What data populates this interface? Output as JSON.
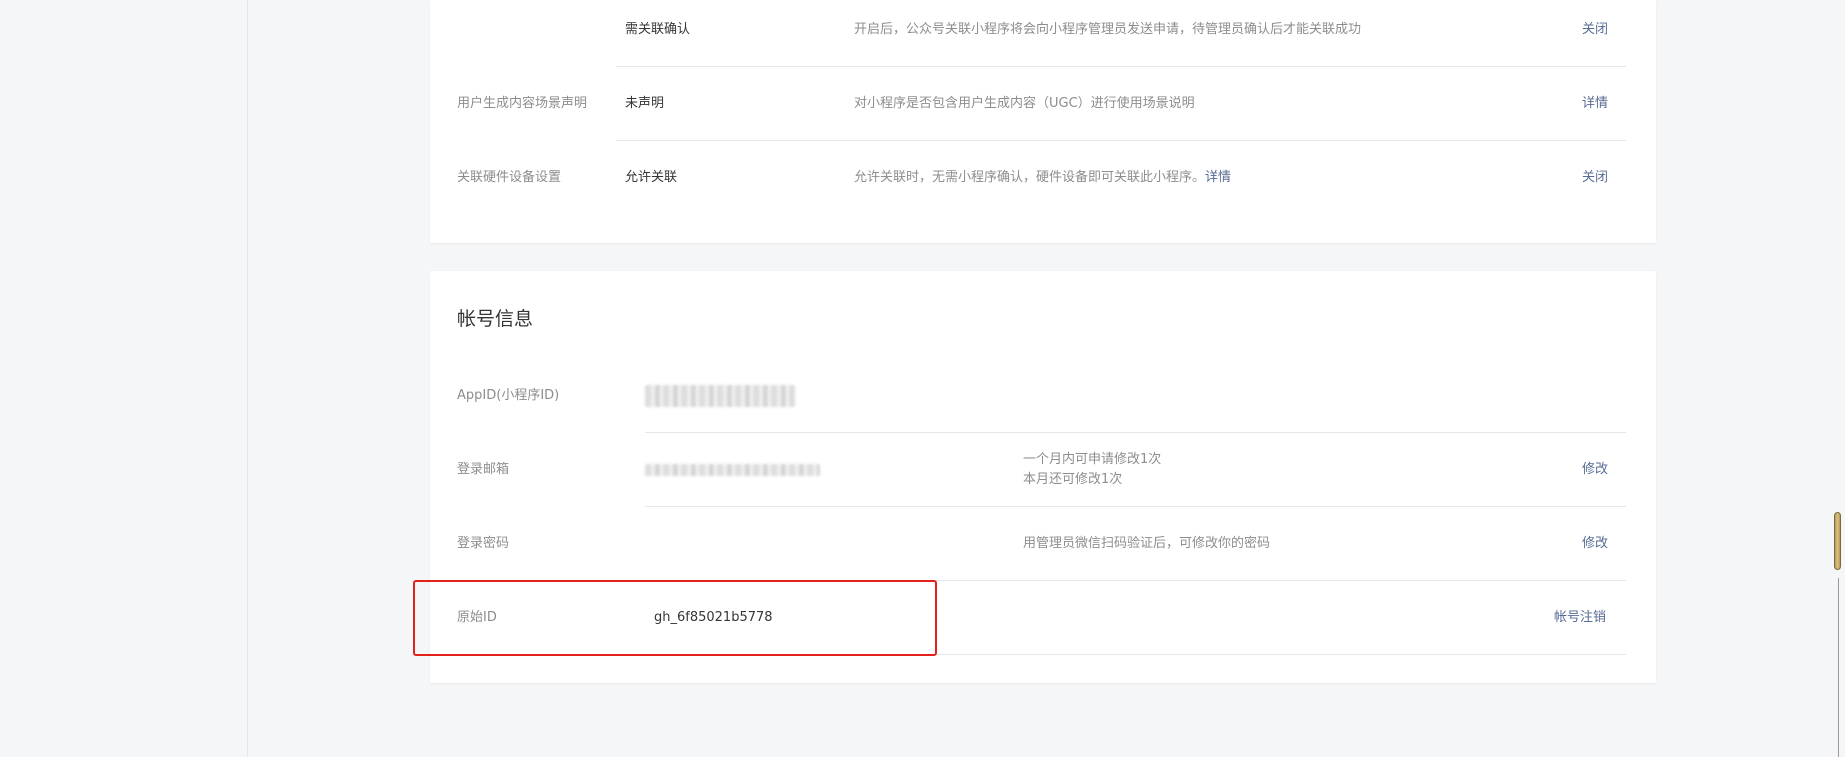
{
  "top_card": {
    "rows": [
      {
        "label": "",
        "value": "需关联确认",
        "desc": "开启后，公众号关联小程序将会向小程序管理员发送申请，待管理员确认后才能关联成功",
        "action": "关闭"
      },
      {
        "label": "用户生成内容场景声明",
        "value": "未声明",
        "desc": "对小程序是否包含用户生成内容（UGC）进行使用场景说明",
        "action": "详情"
      },
      {
        "label": "关联硬件设备设置",
        "value": "允许关联",
        "desc": "允许关联时，无需小程序确认，硬件设备即可关联此小程序。",
        "desc_link": "详情",
        "action": "关闭"
      }
    ]
  },
  "account_card": {
    "title": "帐号信息",
    "appid": {
      "label": "AppID(小程序ID)"
    },
    "email": {
      "label": "登录邮箱",
      "note_line1": "一个月内可申请修改1次",
      "note_line2": "本月还可修改1次",
      "action": "修改"
    },
    "password": {
      "label": "登录密码",
      "note": "用管理员微信扫码验证后，可修改你的密码",
      "action": "修改"
    },
    "original_id": {
      "label": "原始ID",
      "value": "gh_6f85021b5778",
      "action": "帐号注销"
    }
  },
  "colors": {
    "link": "#576b95",
    "highlight": "#e3211b",
    "text_primary": "#353535",
    "text_secondary": "#8d8d8d"
  }
}
